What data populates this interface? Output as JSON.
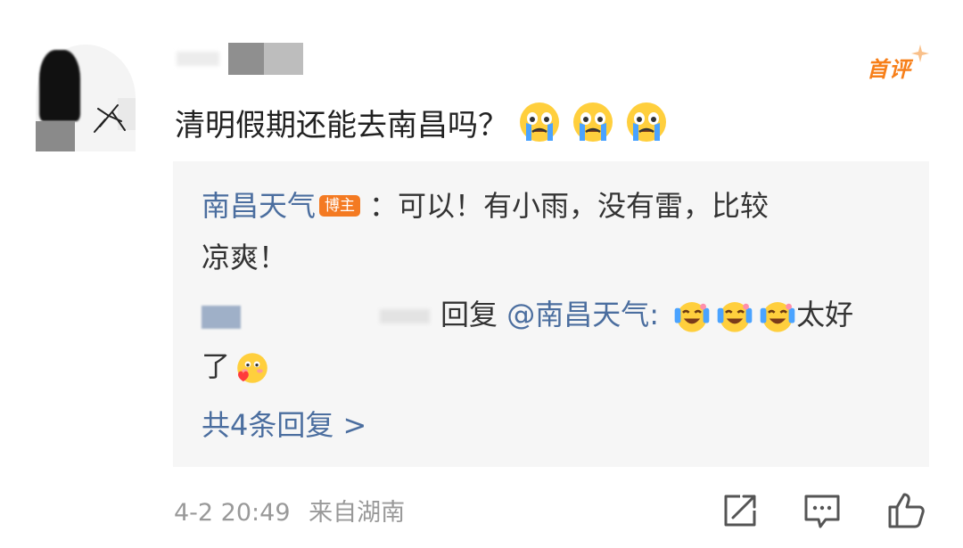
{
  "comment": {
    "text": "清明假期还能去南昌吗？",
    "first_badge": "首评",
    "emojis": [
      "crying-face-emoji",
      "crying-face-emoji",
      "crying-face-emoji"
    ]
  },
  "reply_box": {
    "blogger_reply": {
      "author": "南昌天气",
      "badge": "博主",
      "line1": "：可以！有小雨，没有雷，比较",
      "line2": "凉爽！"
    },
    "user_reply": {
      "reply_word": "回复",
      "mention": "@南昌天气",
      "colon": ":",
      "emojis": [
        "tears-of-joy-emoji",
        "tears-of-joy-emoji",
        "tears-of-joy-emoji"
      ],
      "text1": "太好",
      "text2": "了",
      "end_emoji": "blushing-heart-emoji"
    },
    "more_replies": "共4条回复 >"
  },
  "footer": {
    "time": "4-2 20:49",
    "source": "来自湖南",
    "actions": [
      "share-icon",
      "comment-icon",
      "like-icon"
    ]
  },
  "colors": {
    "link": "#4b6e9f",
    "badge": "#f47a22",
    "first_badge": "#f77f19",
    "reply_bg": "#f6f6f6",
    "meta_text": "#999999"
  }
}
